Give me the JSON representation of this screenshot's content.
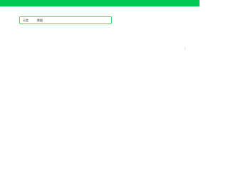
{
  "colors": {
    "header": "#00c853",
    "box_border": "#4cd964"
  },
  "form": {
    "label": "分类",
    "value": "数据"
  }
}
